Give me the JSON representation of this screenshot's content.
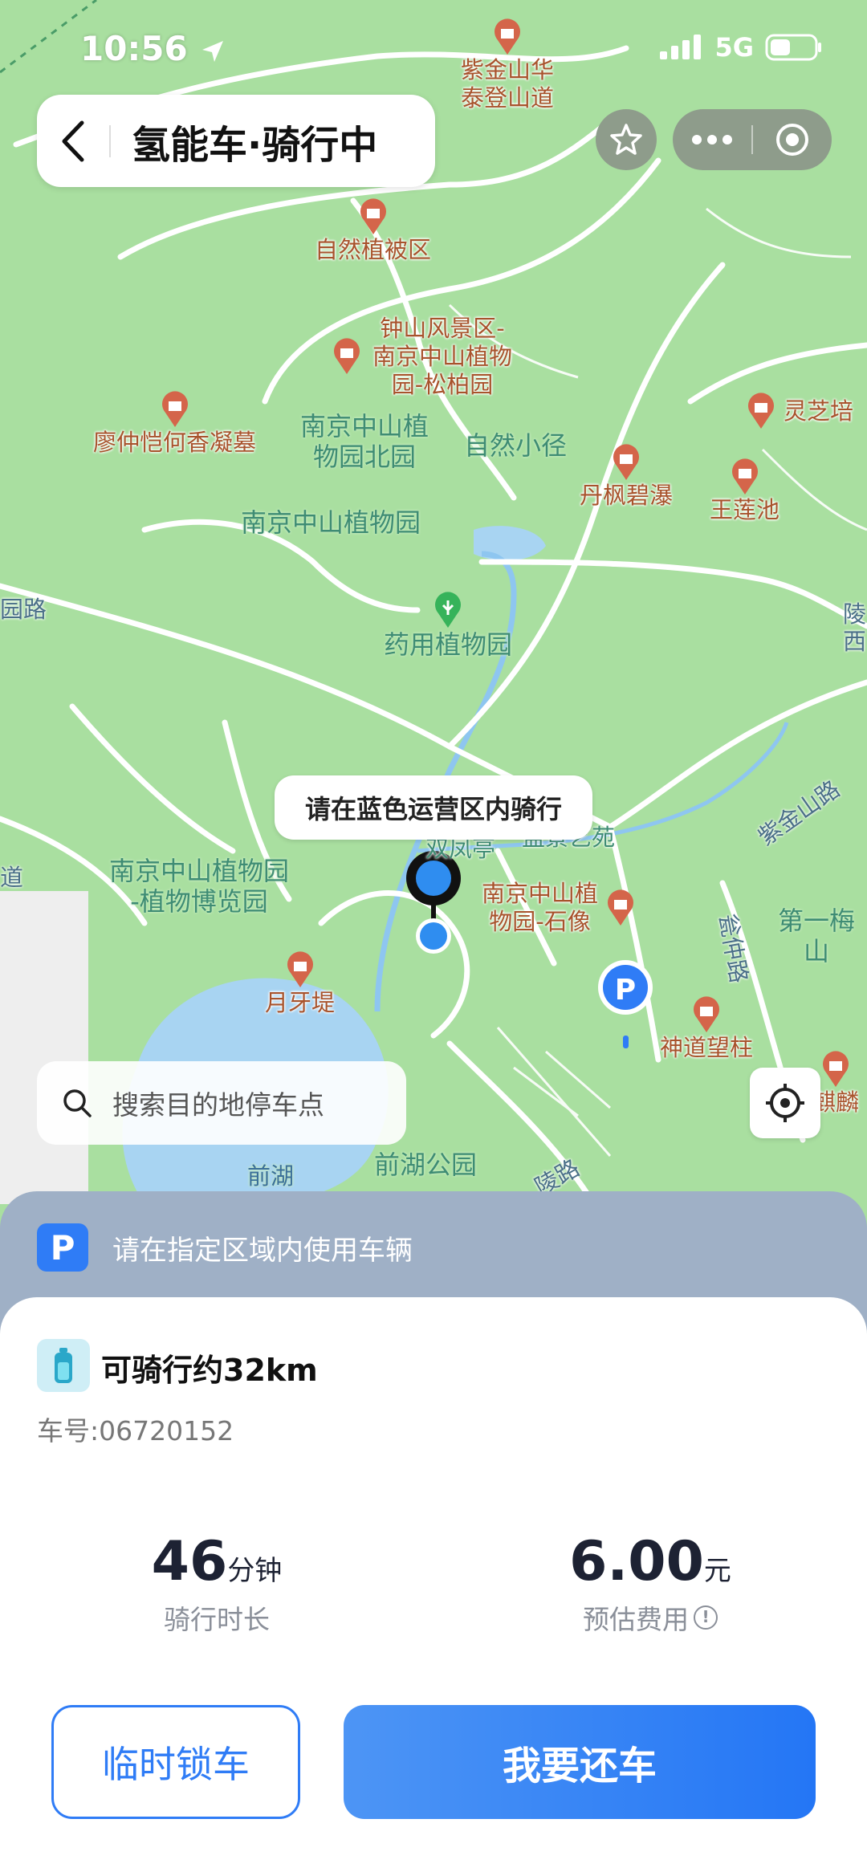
{
  "status_bar": {
    "time": "10:56",
    "network": "5G"
  },
  "header": {
    "title": "氢能车·骑行中"
  },
  "icons": {
    "back": "chevron-left-icon",
    "favorite": "star-icon",
    "more": "more-dots-icon",
    "close": "target-circle-icon",
    "search": "search-icon",
    "locate": "crosshair-icon",
    "parking": "parking-icon",
    "battery": "hydrogen-bottle-icon",
    "info": "info-icon"
  },
  "map": {
    "tip": "请在蓝色运营区内骑行",
    "pois": [
      "紫金山华\n泰登山道",
      "自然植被区",
      "钟山风景区-\n南京中山植物\n园-松柏园",
      "廖仲恺何香凝墓",
      "灵芝培",
      "丹枫碧瀑",
      "王莲池",
      "南京中山植\n物园-石像",
      "月牙堤",
      "神道望柱",
      "麒麟"
    ],
    "areas": [
      "南京中山植\n物园北园",
      "自然小径",
      "南京中山植物园",
      "药用植物园",
      "南京中山植物园\n-植物博览园",
      "前湖",
      "前湖公园",
      "第一梅山"
    ],
    "roads": [
      "园路",
      "陵\n西",
      "紫金山路",
      "瓮仲路",
      "道",
      "双凤亭",
      "盆景艺苑",
      "陵路"
    ]
  },
  "search": {
    "placeholder": "搜索目的地停车点"
  },
  "notice": {
    "icon_text": "P",
    "text": "请在指定区域内使用车辆"
  },
  "ride": {
    "range": "可骑行约32km",
    "plate_label": "车号:",
    "plate_value": "06720152",
    "duration_value": "46",
    "duration_unit": "分钟",
    "duration_label": "骑行时长",
    "fee_value": "6.00",
    "fee_unit": "元",
    "fee_label": "预估费用"
  },
  "buttons": {
    "lock": "临时锁车",
    "return": "我要还车"
  },
  "colors": {
    "accent": "#2f7cf6",
    "map_green": "#a9dfa0",
    "poi_text": "#a8532c"
  }
}
